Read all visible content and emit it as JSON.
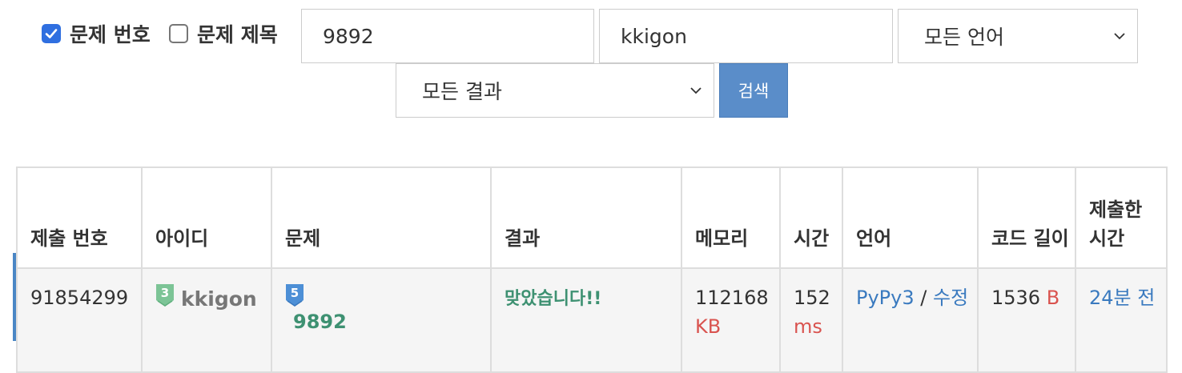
{
  "search": {
    "problem_id_checkbox": {
      "label": "문제 번호",
      "checked": true
    },
    "problem_title_checkbox": {
      "label": "문제 제목",
      "checked": false
    },
    "problem_input": {
      "value": "9892"
    },
    "user_input": {
      "value": "kkigon"
    },
    "language_select": {
      "selected": "모든 언어"
    },
    "result_select": {
      "selected": "모든 결과"
    },
    "search_button": "검색"
  },
  "table": {
    "headers": {
      "submission_id": "제출 번호",
      "user_id": "아이디",
      "problem": "문제",
      "result": "결과",
      "memory": "메모리",
      "time": "시간",
      "language": "언어",
      "code_length": "코드 길이",
      "submitted_at": "제출한 시간"
    },
    "rows": [
      {
        "submission_id": "91854299",
        "user_tier": "3",
        "user_id": "kkigon",
        "problem_tier": "5",
        "problem_id": "9892",
        "result": "맞았습니다!!",
        "memory_value": "112168",
        "memory_unit": "KB",
        "time_value": "152",
        "time_unit": "ms",
        "language": "PyPy3",
        "separator": "/",
        "edit_link": "수정",
        "code_length_value": "1536",
        "code_length_unit": "B",
        "submitted_at": "24분 전"
      }
    ]
  },
  "colors": {
    "accepted": "#3e9172",
    "unit": "#d9534f",
    "link": "#3a7abf",
    "checkbox_on": "#2f6fe0",
    "search_button": "#5a8dc9",
    "row_marker": "#4a86c5",
    "tier_user_green": "#7cc496",
    "tier_problem_blue": "#4d8fd6"
  }
}
